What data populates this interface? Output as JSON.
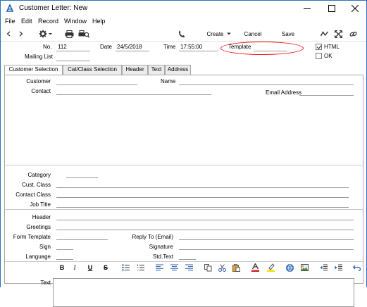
{
  "window": {
    "title": "Customer Letter: New"
  },
  "menu": [
    "File",
    "Edit",
    "Record",
    "Window",
    "Help"
  ],
  "toolbar": {
    "create": "Create",
    "cancel": "Cancel",
    "save": "Save"
  },
  "header": {
    "no_label": "No.",
    "no_value": "112",
    "date_label": "Date",
    "date_value": "24/5/2018",
    "time_label": "Time",
    "time_value": "17:55:00",
    "template_label": "Template",
    "template_value": "",
    "html_label": "HTML",
    "html_checked": true,
    "ok_label": "OK",
    "ok_checked": false,
    "mailing_label": "Mailing List",
    "mailing_value": ""
  },
  "tabs": [
    "Customer Selection",
    "Cat/Class Selection",
    "Header",
    "Text",
    "Address"
  ],
  "fields": {
    "customer": "Customer",
    "name": "Name",
    "contact": "Contact",
    "email": "Email Address",
    "category": "Category",
    "cust_class": "Cust. Class",
    "contact_class": "Contact Class",
    "job_title": "Job Title",
    "header": "Header",
    "greetings": "Greetings",
    "form_template": "Form Template",
    "reply_to": "Reply To (Email)",
    "sign": "Sign",
    "signature": "Signature",
    "language": "Language",
    "std_text": "Std.Text",
    "text": "Text"
  },
  "richtext": {
    "bold": "B",
    "italic": "I",
    "underline": "U",
    "strike": "S"
  },
  "colors": {
    "window_border": "#2b6fc2",
    "highlight_ellipse": "#e11111",
    "font_color_bar": "#d81e1e",
    "highlight_bar": "#f2e300"
  }
}
